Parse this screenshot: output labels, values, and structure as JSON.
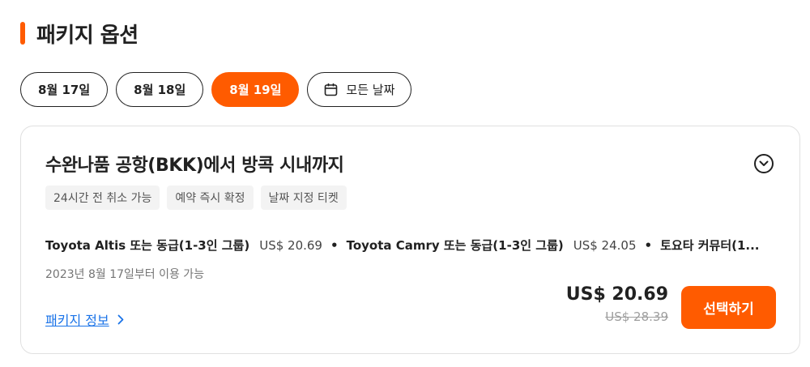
{
  "section": {
    "title": "패키지 옵션"
  },
  "dates": [
    {
      "label": "8월 17일",
      "active": false
    },
    {
      "label": "8월 18일",
      "active": false
    },
    {
      "label": "8월 19일",
      "active": true
    }
  ],
  "all_dates_label": "모든 날짜",
  "card": {
    "title": "수완나품 공항(BKK)에서 방콕 시내까지",
    "tags": [
      "24시간 전 취소 가능",
      "예약 즉시 확정",
      "날짜 지정 티켓"
    ],
    "options": [
      {
        "name": "Toyota Altis 또는 동급(1-3인 그룹)",
        "price": "US$ 20.69"
      },
      {
        "name": "Toyota Camry 또는 동급(1-3인 그룹)",
        "price": "US$ 24.05"
      },
      {
        "name": "토요타 커뮤터(1..."
      }
    ],
    "separator": "•",
    "available_from": "2023년 8월 17일부터 이용 가능",
    "package_info_link": "패키지 정보",
    "price_current": "US$ 20.69",
    "price_original": "US$ 28.39",
    "select_button": "선택하기"
  },
  "colors": {
    "accent": "#ff5b00",
    "link": "#1a73e8"
  },
  "icons": {
    "calendar": "calendar-icon",
    "expand": "chevron-down-circle-icon",
    "link_arrow": "chevron-right-icon"
  }
}
